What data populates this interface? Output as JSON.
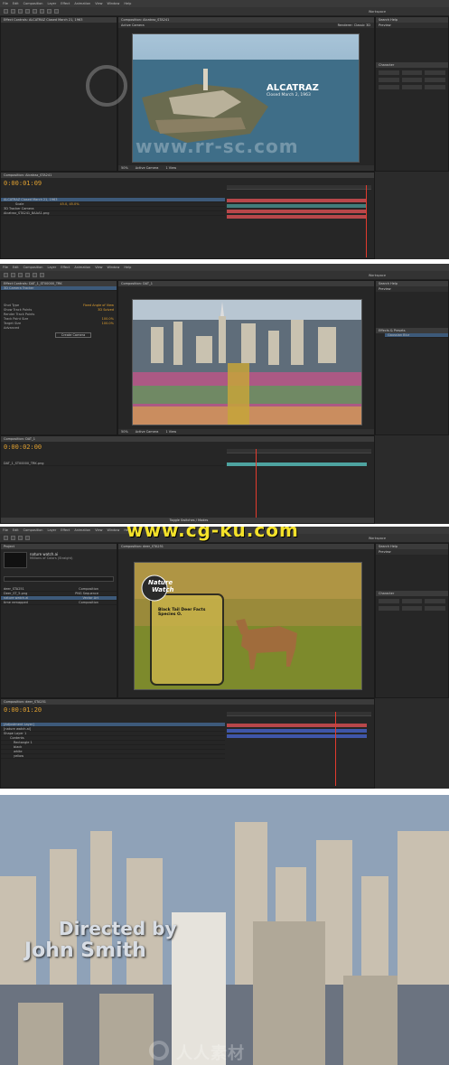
{
  "menu": [
    "File",
    "Edit",
    "Composition",
    "Layer",
    "Effect",
    "Animation",
    "View",
    "Window",
    "Help"
  ],
  "workspace_label": "Workspace",
  "shot1": {
    "project_tab": "Effect Controls: ALCATRAZ Closed March 21, 1963",
    "comp_tab": "Composition: Alcatraz_STA241",
    "viewer_tab": "Active Camera",
    "renderer": "Renderer: Classic 3D",
    "search_help": "Search Help",
    "preview": "Preview",
    "title_line1": "ALCATRAZ",
    "title_line2": "Closed March 2, 1963",
    "watermark": "www.rr-sc.com",
    "timecode": "0:00:01:09",
    "zoom": "50%",
    "layers": [
      {
        "name": "ALCATRAZ Closed March 21, 1963",
        "mode": "Normal"
      },
      {
        "name": "3D Tracker Camera",
        "mode": ""
      },
      {
        "name": "Alcatraz_STA241_8AAA1.png",
        "mode": "Normal"
      }
    ],
    "sub_prop": "Scale",
    "sub_val": "45.0, 45.0%",
    "view_label": "Active Camera",
    "view_count": "1 View",
    "paragraph": "Paragraph",
    "character": "Character"
  },
  "shot2": {
    "project_tab": "Effect Controls: DAT_1_ST00000_TRK",
    "comp_tab": "Composition: DAT_1",
    "effect_name": "3D Camera Tracker",
    "props": [
      {
        "label": "Shot Type",
        "value": "Fixed Angle of View"
      },
      {
        "label": "Show Track Points",
        "value": "3D Solved"
      },
      {
        "label": "Render Track Points",
        "value": ""
      },
      {
        "label": "Track Point Size",
        "value": "100.0%"
      },
      {
        "label": "Target Size",
        "value": "100.0%"
      },
      {
        "label": "Advanced",
        "value": ""
      }
    ],
    "create_camera": "Create Camera",
    "timecode": "0:00:02:00",
    "layers": [
      {
        "name": "DAT_1_ST00000_TRK.png",
        "mode": "Normal"
      }
    ],
    "effects_tab": "Effects & Presets",
    "effect_item": "Gaussian Blur",
    "toggle": "Toggle Switches / Modes"
  },
  "shot3": {
    "project_tab": "Project",
    "comp_tab": "Composition: deer_STA251",
    "file_name": "nature watch.ai",
    "file_sub": "Millions of Colors (Straight)",
    "items": [
      {
        "name": "deer_STA251",
        "type": "Composition"
      },
      {
        "name": "Deer_ST_5.png",
        "type": "PNG Sequence"
      },
      {
        "name": "nature watch.ai",
        "type": "Vector Art"
      },
      {
        "name": "time remapped",
        "type": "Composition"
      }
    ],
    "badge_line1": "Nature",
    "badge_line2": "Watch",
    "card_line1": "Black Tail Deer Facts",
    "card_line2": "Species O.",
    "timecode": "0:00:01:20",
    "layers": [
      {
        "name": "[Adjustment Layer]",
        "mode": "Normal"
      },
      {
        "name": "[nature watch.ai]",
        "mode": "Normal"
      },
      {
        "name": "Shape Layer 1",
        "mode": "Normal"
      },
      {
        "name": "Contents",
        "mode": ""
      },
      {
        "name": "Rectangle 1",
        "mode": "Normal"
      },
      {
        "name": "black",
        "mode": "Normal"
      },
      {
        "name": "white",
        "mode": "Normal"
      },
      {
        "name": "yellow",
        "mode": "Normal"
      }
    ],
    "banner": "www.cg-ku.com"
  },
  "shot4": {
    "line1": "Directed by",
    "line2": "John Smith",
    "watermark": "人人素材"
  },
  "colors": {
    "accent_timecode": "#e0a030",
    "track_red": "#b8474a",
    "track_blue": "#3f56a8",
    "track_teal": "#4ea3a0",
    "banner_yellow": "#f4e22a"
  }
}
